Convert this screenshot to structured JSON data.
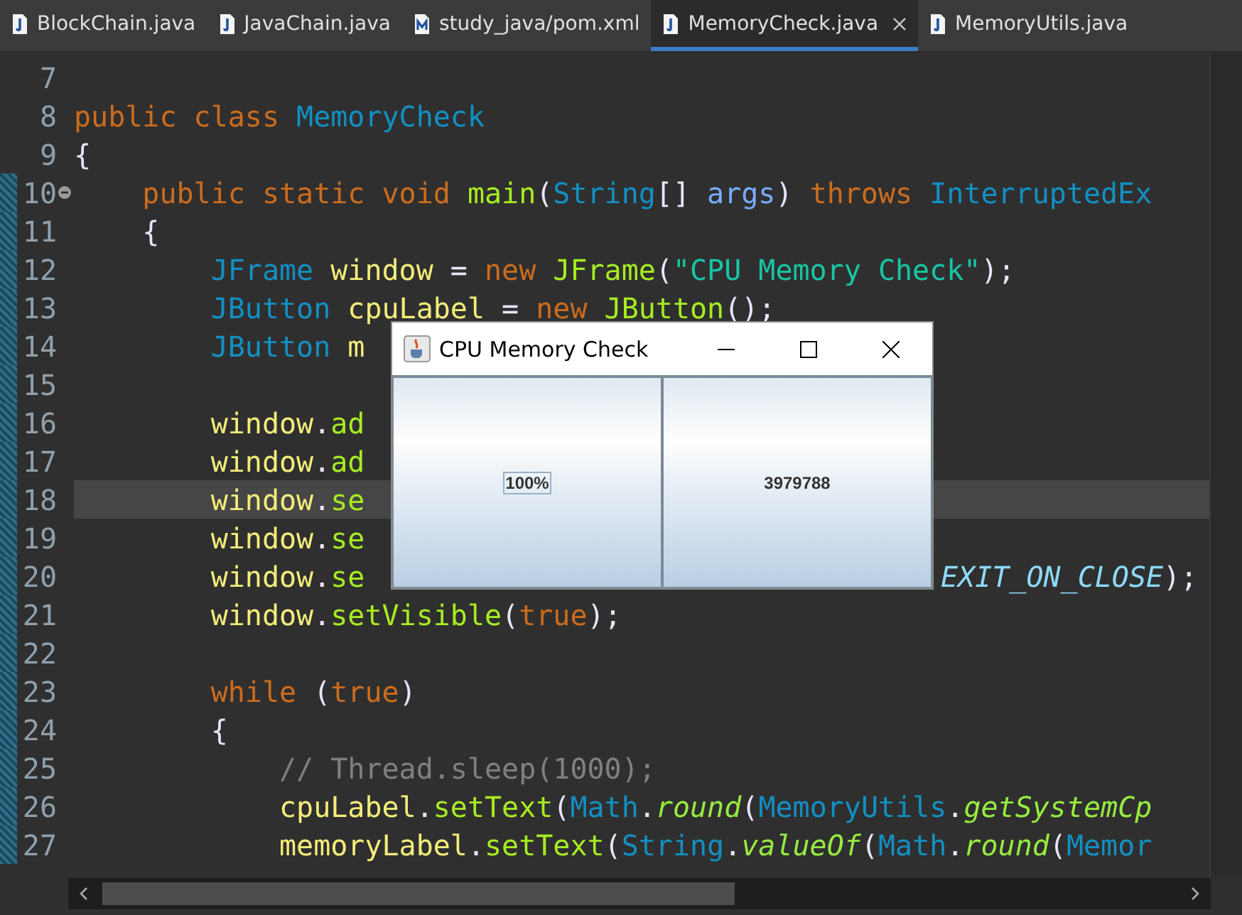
{
  "tabs": [
    {
      "label": "BlockChain.java",
      "kind": "source",
      "selected": false
    },
    {
      "label": "JavaChain.java",
      "kind": "source",
      "selected": false
    },
    {
      "label": "study_java/pom.xml",
      "kind": "pom",
      "selected": false
    },
    {
      "label": "MemoryCheck.java",
      "kind": "source",
      "selected": true
    },
    {
      "label": "MemoryUtils.java",
      "kind": "source",
      "selected": false
    }
  ],
  "editor": {
    "lines": [
      {
        "number": "7",
        "changed": false,
        "current": false,
        "fold_marker": false
      },
      {
        "number": "8",
        "changed": false,
        "current": false,
        "fold_marker": false,
        "tokens": [
          {
            "kind": "keyword",
            "text": "public class "
          },
          {
            "kind": "type",
            "text": "MemoryCheck"
          }
        ]
      },
      {
        "number": "9",
        "changed": false,
        "current": false,
        "fold_marker": false,
        "tokens": [
          {
            "kind": "plain",
            "text": "{"
          }
        ]
      },
      {
        "number": "10",
        "changed": true,
        "current": false,
        "fold_marker": true,
        "tokens": [
          {
            "kind": "keyword",
            "text": "    public static void "
          },
          {
            "kind": "method",
            "text": "main"
          },
          {
            "kind": "plain",
            "text": "("
          },
          {
            "kind": "type",
            "text": "String"
          },
          {
            "kind": "plain",
            "text": "[] "
          },
          {
            "kind": "param",
            "text": "args"
          },
          {
            "kind": "plain",
            "text": ") "
          },
          {
            "kind": "keyword",
            "text": "throws "
          },
          {
            "kind": "type",
            "text": "InterruptedEx"
          }
        ]
      },
      {
        "number": "11",
        "changed": true,
        "current": false,
        "fold_marker": false,
        "tokens": [
          {
            "kind": "plain",
            "text": "    {"
          }
        ]
      },
      {
        "number": "12",
        "changed": true,
        "current": false,
        "fold_marker": false,
        "tokens": [
          {
            "kind": "type",
            "text": "        JFrame "
          },
          {
            "kind": "variable",
            "text": "window"
          },
          {
            "kind": "plain",
            "text": " = "
          },
          {
            "kind": "keyword",
            "text": "new "
          },
          {
            "kind": "method",
            "text": "JFrame"
          },
          {
            "kind": "plain",
            "text": "("
          },
          {
            "kind": "string",
            "text": "\"CPU Memory Check\""
          },
          {
            "kind": "plain",
            "text": ");"
          }
        ]
      },
      {
        "number": "13",
        "changed": true,
        "current": false,
        "fold_marker": false,
        "tokens": [
          {
            "kind": "type",
            "text": "        JButton "
          },
          {
            "kind": "variable",
            "text": "cpuLabel"
          },
          {
            "kind": "plain",
            "text": " = "
          },
          {
            "kind": "keyword",
            "text": "new "
          },
          {
            "kind": "method",
            "text": "JButton"
          },
          {
            "kind": "plain",
            "text": "();"
          }
        ]
      },
      {
        "number": "14",
        "changed": true,
        "current": false,
        "fold_marker": false,
        "tokens": [
          {
            "kind": "type",
            "text": "        JButton "
          },
          {
            "kind": "variable",
            "text": "m"
          }
        ]
      },
      {
        "number": "15",
        "changed": true,
        "current": false,
        "fold_marker": false
      },
      {
        "number": "16",
        "changed": true,
        "current": false,
        "fold_marker": false,
        "tokens": [
          {
            "kind": "variable",
            "text": "        window"
          },
          {
            "kind": "plain",
            "text": "."
          },
          {
            "kind": "method",
            "text": "ad"
          }
        ]
      },
      {
        "number": "17",
        "changed": true,
        "current": false,
        "fold_marker": false,
        "tokens": [
          {
            "kind": "variable",
            "text": "        window"
          },
          {
            "kind": "plain",
            "text": "."
          },
          {
            "kind": "method",
            "text": "ad"
          }
        ]
      },
      {
        "number": "18",
        "changed": true,
        "current": true,
        "fold_marker": false,
        "tokens": [
          {
            "kind": "variable",
            "text": "        window"
          },
          {
            "kind": "plain",
            "text": "."
          },
          {
            "kind": "method",
            "text": "se"
          }
        ]
      },
      {
        "number": "19",
        "changed": true,
        "current": false,
        "fold_marker": false,
        "tokens": [
          {
            "kind": "variable",
            "text": "        window"
          },
          {
            "kind": "plain",
            "text": "."
          },
          {
            "kind": "method",
            "text": "se"
          }
        ]
      },
      {
        "number": "20",
        "changed": true,
        "current": false,
        "fold_marker": false,
        "tokens": [
          {
            "kind": "variable",
            "text": "        window"
          },
          {
            "kind": "plain",
            "text": "."
          },
          {
            "kind": "method",
            "text": "se"
          }
        ],
        "after_tokens": [
          {
            "kind": "constant",
            "text": "EXIT_ON_CLOSE"
          },
          {
            "kind": "plain",
            "text": ");"
          }
        ]
      },
      {
        "number": "21",
        "changed": true,
        "current": false,
        "fold_marker": false,
        "tokens": [
          {
            "kind": "variable",
            "text": "        window"
          },
          {
            "kind": "plain",
            "text": "."
          },
          {
            "kind": "method",
            "text": "setVisible"
          },
          {
            "kind": "plain",
            "text": "("
          },
          {
            "kind": "keyword",
            "text": "true"
          },
          {
            "kind": "plain",
            "text": ");"
          }
        ]
      },
      {
        "number": "22",
        "changed": true,
        "current": false,
        "fold_marker": false
      },
      {
        "number": "23",
        "changed": true,
        "current": false,
        "fold_marker": false,
        "tokens": [
          {
            "kind": "keyword",
            "text": "        while"
          },
          {
            "kind": "plain",
            "text": " ("
          },
          {
            "kind": "keyword",
            "text": "true"
          },
          {
            "kind": "plain",
            "text": ")"
          }
        ]
      },
      {
        "number": "24",
        "changed": true,
        "current": false,
        "fold_marker": false,
        "tokens": [
          {
            "kind": "plain",
            "text": "        {"
          }
        ]
      },
      {
        "number": "25",
        "changed": true,
        "current": false,
        "fold_marker": false,
        "tokens": [
          {
            "kind": "comment",
            "text": "            // Thread.sleep(1000);"
          }
        ]
      },
      {
        "number": "26",
        "changed": true,
        "current": false,
        "fold_marker": false,
        "tokens": [
          {
            "kind": "variable",
            "text": "            cpuLabel"
          },
          {
            "kind": "plain",
            "text": "."
          },
          {
            "kind": "method",
            "text": "setText"
          },
          {
            "kind": "plain",
            "text": "("
          },
          {
            "kind": "type",
            "text": "Math"
          },
          {
            "kind": "plain",
            "text": "."
          },
          {
            "kind": "static_method",
            "text": "round"
          },
          {
            "kind": "plain",
            "text": "("
          },
          {
            "kind": "type",
            "text": "MemoryUtils"
          },
          {
            "kind": "plain",
            "text": "."
          },
          {
            "kind": "static_method",
            "text": "getSystemCp"
          }
        ]
      },
      {
        "number": "27",
        "changed": true,
        "current": false,
        "fold_marker": false,
        "tokens": [
          {
            "kind": "variable",
            "text": "            memoryLabel"
          },
          {
            "kind": "plain",
            "text": "."
          },
          {
            "kind": "method",
            "text": "setText"
          },
          {
            "kind": "plain",
            "text": "("
          },
          {
            "kind": "type",
            "text": "String"
          },
          {
            "kind": "plain",
            "text": "."
          },
          {
            "kind": "static_method",
            "text": "valueOf"
          },
          {
            "kind": "plain",
            "text": "("
          },
          {
            "kind": "type",
            "text": "Math"
          },
          {
            "kind": "plain",
            "text": "."
          },
          {
            "kind": "static_method",
            "text": "round"
          },
          {
            "kind": "plain",
            "text": "("
          },
          {
            "kind": "type",
            "text": "Memor"
          }
        ]
      }
    ]
  },
  "dialog": {
    "title": "CPU Memory Check",
    "buttons": [
      {
        "label": "100%",
        "focused": true
      },
      {
        "label": "3979788",
        "focused": false
      }
    ]
  }
}
